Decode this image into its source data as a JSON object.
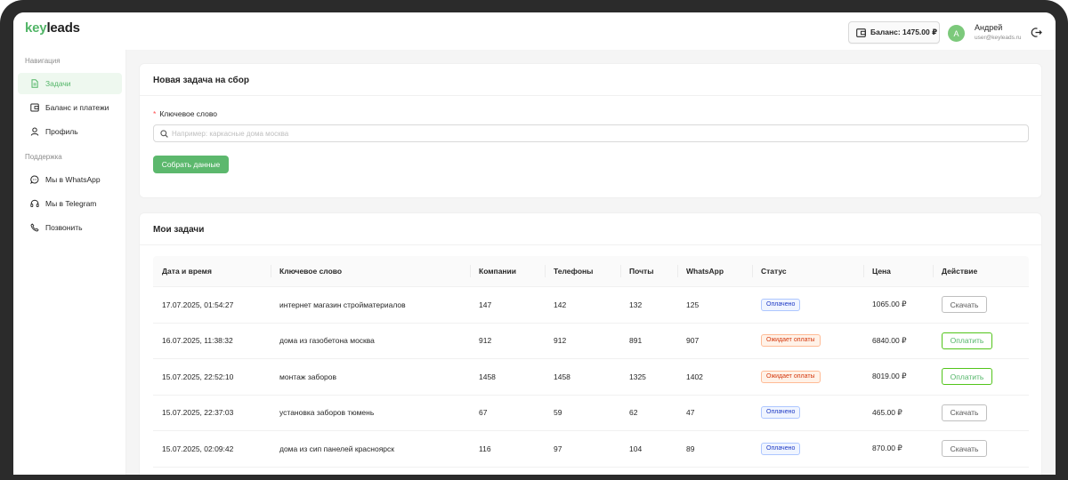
{
  "app": {
    "logo_part1": "key",
    "logo_part2": "leads"
  },
  "header": {
    "balance_label": "Баланс: 1475.00 ₽",
    "user": {
      "avatar_letter": "А",
      "name": "Андрей",
      "email": "user@keyleads.ru"
    }
  },
  "sidebar": {
    "nav_heading": "Навигация",
    "nav_items": [
      {
        "label": "Задачи",
        "icon": "file-icon",
        "active": true
      },
      {
        "label": "Баланс и платежи",
        "icon": "wallet-icon"
      },
      {
        "label": "Профиль",
        "icon": "user-icon"
      }
    ],
    "support_heading": "Поддержка",
    "support_items": [
      {
        "label": "Мы в WhatsApp",
        "icon": "chat-icon"
      },
      {
        "label": "Мы в Telegram",
        "icon": "headset-icon"
      },
      {
        "label": "Позвонить",
        "icon": "phone-icon"
      }
    ]
  },
  "new_task": {
    "title": "Новая задача на сбор",
    "required_mark": "*",
    "field_label": "Ключевое слово",
    "placeholder": "Например: каркасные дома москва",
    "value": "",
    "submit_label": "Собрать данные"
  },
  "tasks": {
    "title": "Мои задачи",
    "columns": [
      "Дата и время",
      "Ключевое слово",
      "Компании",
      "Телефоны",
      "Почты",
      "WhatsApp",
      "Статус",
      "Цена",
      "Действие"
    ],
    "rows": [
      {
        "datetime": "17.07.2025, 01:54:27",
        "keyword": "интернет магазин стройматериалов",
        "companies": "147",
        "phones": "142",
        "emails": "132",
        "whatsapp": "125",
        "status": "Оплачено",
        "status_type": "paid",
        "price": "1065.00 ₽",
        "action": "Скачать",
        "action_type": "download"
      },
      {
        "datetime": "16.07.2025, 11:38:32",
        "keyword": "дома из газобетона москва",
        "companies": "912",
        "phones": "912",
        "emails": "891",
        "whatsapp": "907",
        "status": "Ожидает оплаты",
        "status_type": "pending",
        "price": "6840.00 ₽",
        "action": "Оплатить",
        "action_type": "pay"
      },
      {
        "datetime": "15.07.2025, 22:52:10",
        "keyword": "монтаж заборов",
        "companies": "1458",
        "phones": "1458",
        "emails": "1325",
        "whatsapp": "1402",
        "status": "Ожидает оплаты",
        "status_type": "pending",
        "price": "8019.00 ₽",
        "action": "Оплатить",
        "action_type": "pay"
      },
      {
        "datetime": "15.07.2025, 22:37:03",
        "keyword": "установка заборов тюмень",
        "companies": "67",
        "phones": "59",
        "emails": "62",
        "whatsapp": "47",
        "status": "Оплачено",
        "status_type": "paid",
        "price": "465.00 ₽",
        "action": "Скачать",
        "action_type": "download"
      },
      {
        "datetime": "15.07.2025, 02:09:42",
        "keyword": "дома из сип панелей красноярск",
        "companies": "116",
        "phones": "97",
        "emails": "104",
        "whatsapp": "89",
        "status": "Оплачено",
        "status_type": "paid",
        "price": "870.00 ₽",
        "action": "Скачать",
        "action_type": "download"
      }
    ]
  },
  "colors": {
    "brand": "#52b567",
    "paid_tag": "#1d39c4",
    "pending_tag": "#d4380d"
  }
}
